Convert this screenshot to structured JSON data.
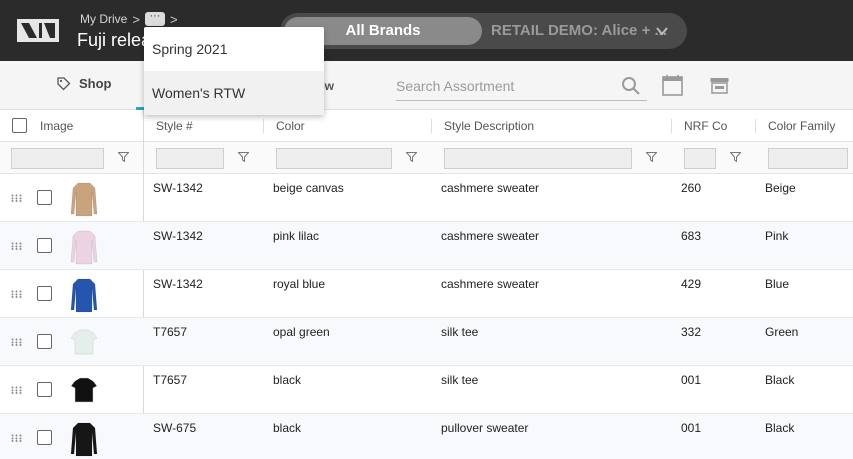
{
  "header": {
    "breadcrumb_root": "My Drive",
    "breadcrumb_sep": ">",
    "more_label": "···",
    "title": "Fuji relea",
    "brand_toggle": {
      "active": "All Brands",
      "inactive": "RETAIL DEMO: Alice + ..."
    }
  },
  "dropdown": {
    "items": [
      "Spring 2021",
      "Women's RTW"
    ]
  },
  "toolbar": {
    "shop_label": "Shop",
    "view_label": "ew",
    "search_placeholder": "Search Assortment"
  },
  "table": {
    "headers": {
      "image": "Image",
      "style": "Style #",
      "color": "Color",
      "description": "Style Description",
      "nrf": "NRF Co",
      "family": "Color Family"
    },
    "rows": [
      {
        "style": "SW-1342",
        "color": "beige canvas",
        "description": "cashmere sweater",
        "nrf": "260",
        "family": "Beige",
        "swatch": "#c9a27e",
        "garment": "long-sleeve"
      },
      {
        "style": "SW-1342",
        "color": "pink lilac",
        "description": "cashmere sweater",
        "nrf": "683",
        "family": "Pink",
        "swatch": "#ecd3e4",
        "garment": "long-sleeve"
      },
      {
        "style": "SW-1342",
        "color": "royal blue",
        "description": "cashmere sweater",
        "nrf": "429",
        "family": "Blue",
        "swatch": "#2456b0",
        "garment": "long-sleeve"
      },
      {
        "style": "T7657",
        "color": "opal green",
        "description": "silk tee",
        "nrf": "332",
        "family": "Green",
        "swatch": "#e3efe8",
        "garment": "tee"
      },
      {
        "style": "T7657",
        "color": "black",
        "description": "silk tee",
        "nrf": "001",
        "family": "Black",
        "swatch": "#111111",
        "garment": "tee"
      },
      {
        "style": "SW-675",
        "color": "black",
        "description": "pullover sweater",
        "nrf": "001",
        "family": "Black",
        "swatch": "#161616",
        "garment": "long-sleeve"
      }
    ]
  },
  "colors": {
    "topbar": "#2b2b2b",
    "accent": "#2aa6c0"
  }
}
